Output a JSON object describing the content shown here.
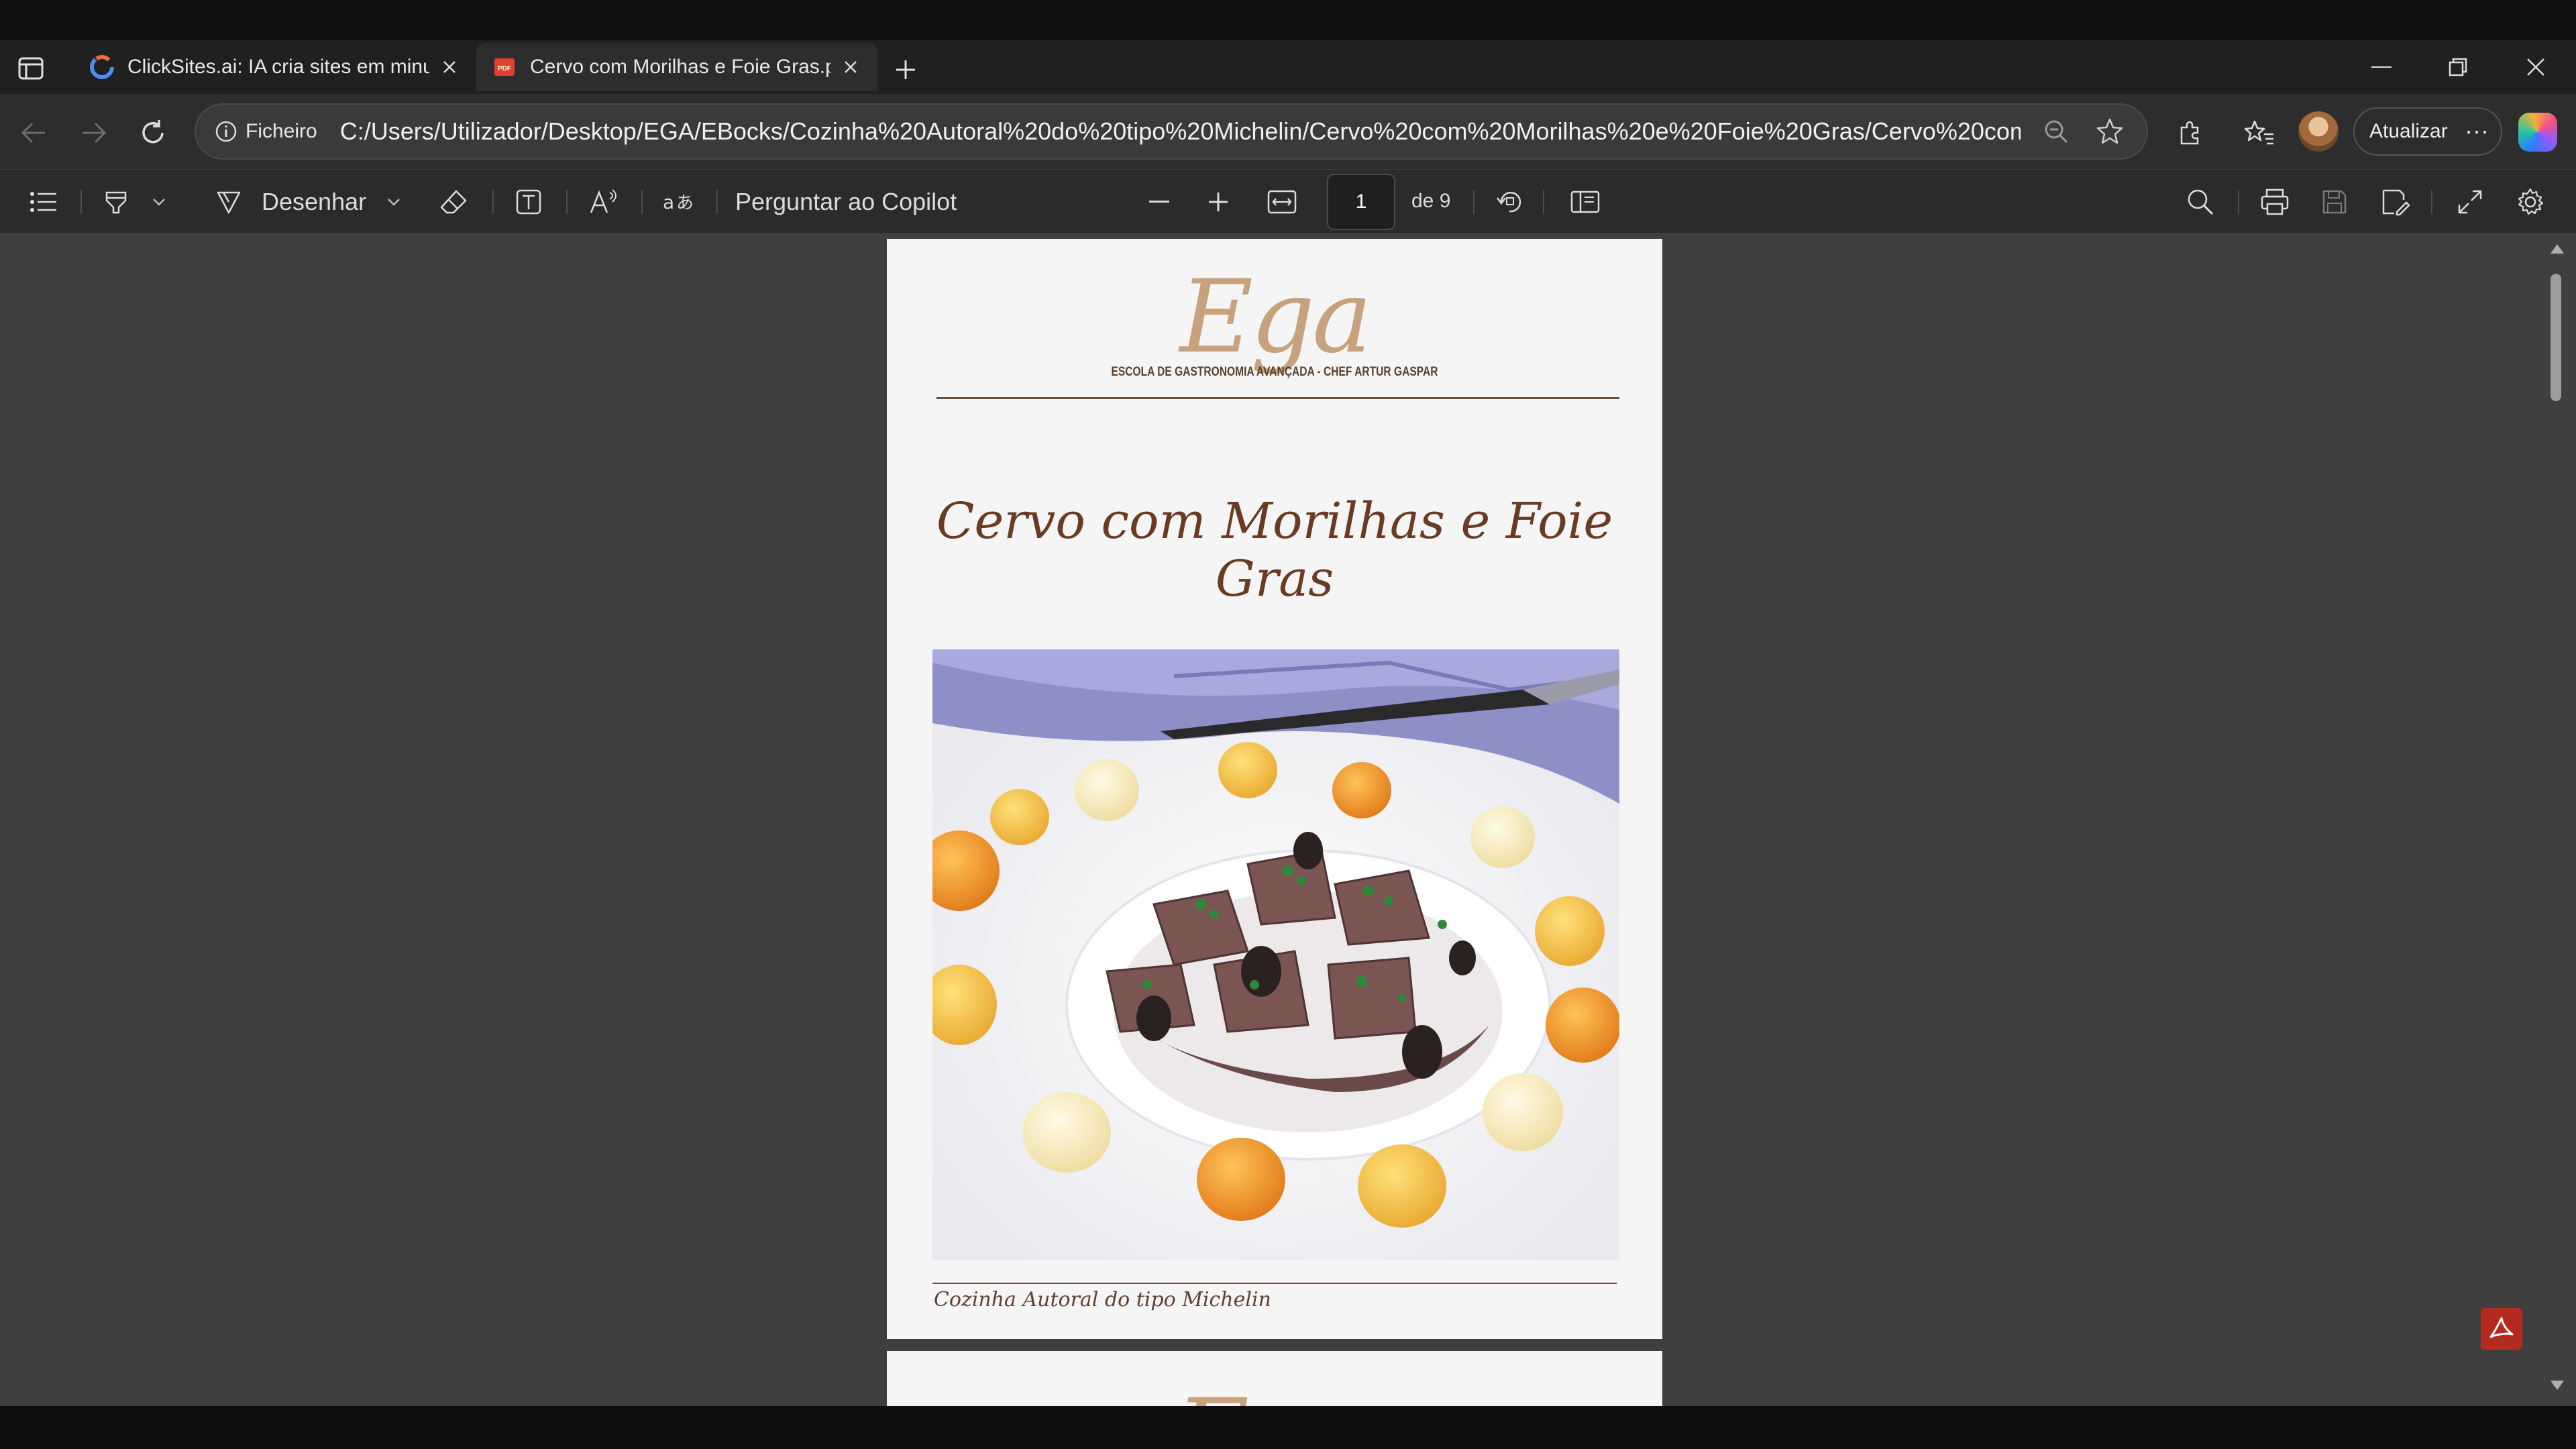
{
  "browser": {
    "tabs": [
      {
        "title": "ClickSites.ai: IA cria sites em minu",
        "active": false,
        "icon": "clicksites-favicon"
      },
      {
        "title": "Cervo com Morilhas e Foie Gras.p",
        "active": true,
        "icon": "pdf-favicon"
      }
    ],
    "address": {
      "site_label": "Ficheiro",
      "url": "C:/Users/Utilizador/Desktop/EGA/EBocks/Cozinha%20Autoral%20do%20tipo%20Michelin/Cervo%20com%20Morilhas%20e%20Foie%20Gras/Cervo%20com%20M..."
    },
    "update_label": "Atualizar",
    "more_label": "···"
  },
  "pdf_toolbar": {
    "draw_label": "Desenhar",
    "copilot_label": "Perguntar ao Copilot",
    "page_current": "1",
    "page_total": "de 9"
  },
  "document": {
    "logo_text": "Ega",
    "logo_subtitle": "ESCOLA DE GASTRONOMIA AVANÇADA - CHEF ARTUR GASPAR",
    "title": "Cervo com Morilhas e Foie Gras",
    "footer": "Cozinha Autoral do tipo Michelin"
  },
  "colors": {
    "accent_gold": "#c7a27c",
    "title_brown": "#6a3a22",
    "viewer_bg": "#3f3f3f",
    "adobe_red": "#b52a1e"
  }
}
